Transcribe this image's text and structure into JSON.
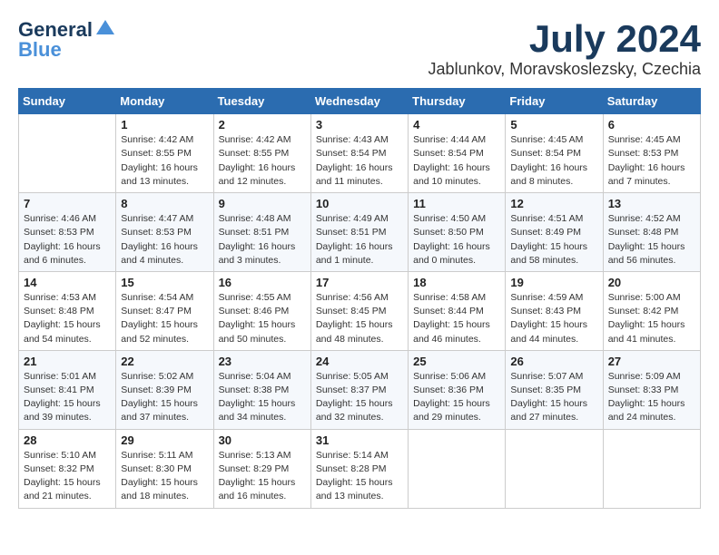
{
  "header": {
    "logo_general": "General",
    "logo_blue": "Blue",
    "title": "July 2024",
    "subtitle": "Jablunkov, Moravskoslezsky, Czechia"
  },
  "days_of_week": [
    "Sunday",
    "Monday",
    "Tuesday",
    "Wednesday",
    "Thursday",
    "Friday",
    "Saturday"
  ],
  "weeks": [
    [
      {
        "day": "",
        "content": ""
      },
      {
        "day": "1",
        "content": "Sunrise: 4:42 AM\nSunset: 8:55 PM\nDaylight: 16 hours\nand 13 minutes."
      },
      {
        "day": "2",
        "content": "Sunrise: 4:42 AM\nSunset: 8:55 PM\nDaylight: 16 hours\nand 12 minutes."
      },
      {
        "day": "3",
        "content": "Sunrise: 4:43 AM\nSunset: 8:54 PM\nDaylight: 16 hours\nand 11 minutes."
      },
      {
        "day": "4",
        "content": "Sunrise: 4:44 AM\nSunset: 8:54 PM\nDaylight: 16 hours\nand 10 minutes."
      },
      {
        "day": "5",
        "content": "Sunrise: 4:45 AM\nSunset: 8:54 PM\nDaylight: 16 hours\nand 8 minutes."
      },
      {
        "day": "6",
        "content": "Sunrise: 4:45 AM\nSunset: 8:53 PM\nDaylight: 16 hours\nand 7 minutes."
      }
    ],
    [
      {
        "day": "7",
        "content": "Sunrise: 4:46 AM\nSunset: 8:53 PM\nDaylight: 16 hours\nand 6 minutes."
      },
      {
        "day": "8",
        "content": "Sunrise: 4:47 AM\nSunset: 8:53 PM\nDaylight: 16 hours\nand 4 minutes."
      },
      {
        "day": "9",
        "content": "Sunrise: 4:48 AM\nSunset: 8:51 PM\nDaylight: 16 hours\nand 3 minutes."
      },
      {
        "day": "10",
        "content": "Sunrise: 4:49 AM\nSunset: 8:51 PM\nDaylight: 16 hours\nand 1 minute."
      },
      {
        "day": "11",
        "content": "Sunrise: 4:50 AM\nSunset: 8:50 PM\nDaylight: 16 hours\nand 0 minutes."
      },
      {
        "day": "12",
        "content": "Sunrise: 4:51 AM\nSunset: 8:49 PM\nDaylight: 15 hours\nand 58 minutes."
      },
      {
        "day": "13",
        "content": "Sunrise: 4:52 AM\nSunset: 8:48 PM\nDaylight: 15 hours\nand 56 minutes."
      }
    ],
    [
      {
        "day": "14",
        "content": "Sunrise: 4:53 AM\nSunset: 8:48 PM\nDaylight: 15 hours\nand 54 minutes."
      },
      {
        "day": "15",
        "content": "Sunrise: 4:54 AM\nSunset: 8:47 PM\nDaylight: 15 hours\nand 52 minutes."
      },
      {
        "day": "16",
        "content": "Sunrise: 4:55 AM\nSunset: 8:46 PM\nDaylight: 15 hours\nand 50 minutes."
      },
      {
        "day": "17",
        "content": "Sunrise: 4:56 AM\nSunset: 8:45 PM\nDaylight: 15 hours\nand 48 minutes."
      },
      {
        "day": "18",
        "content": "Sunrise: 4:58 AM\nSunset: 8:44 PM\nDaylight: 15 hours\nand 46 minutes."
      },
      {
        "day": "19",
        "content": "Sunrise: 4:59 AM\nSunset: 8:43 PM\nDaylight: 15 hours\nand 44 minutes."
      },
      {
        "day": "20",
        "content": "Sunrise: 5:00 AM\nSunset: 8:42 PM\nDaylight: 15 hours\nand 41 minutes."
      }
    ],
    [
      {
        "day": "21",
        "content": "Sunrise: 5:01 AM\nSunset: 8:41 PM\nDaylight: 15 hours\nand 39 minutes."
      },
      {
        "day": "22",
        "content": "Sunrise: 5:02 AM\nSunset: 8:39 PM\nDaylight: 15 hours\nand 37 minutes."
      },
      {
        "day": "23",
        "content": "Sunrise: 5:04 AM\nSunset: 8:38 PM\nDaylight: 15 hours\nand 34 minutes."
      },
      {
        "day": "24",
        "content": "Sunrise: 5:05 AM\nSunset: 8:37 PM\nDaylight: 15 hours\nand 32 minutes."
      },
      {
        "day": "25",
        "content": "Sunrise: 5:06 AM\nSunset: 8:36 PM\nDaylight: 15 hours\nand 29 minutes."
      },
      {
        "day": "26",
        "content": "Sunrise: 5:07 AM\nSunset: 8:35 PM\nDaylight: 15 hours\nand 27 minutes."
      },
      {
        "day": "27",
        "content": "Sunrise: 5:09 AM\nSunset: 8:33 PM\nDaylight: 15 hours\nand 24 minutes."
      }
    ],
    [
      {
        "day": "28",
        "content": "Sunrise: 5:10 AM\nSunset: 8:32 PM\nDaylight: 15 hours\nand 21 minutes."
      },
      {
        "day": "29",
        "content": "Sunrise: 5:11 AM\nSunset: 8:30 PM\nDaylight: 15 hours\nand 18 minutes."
      },
      {
        "day": "30",
        "content": "Sunrise: 5:13 AM\nSunset: 8:29 PM\nDaylight: 15 hours\nand 16 minutes."
      },
      {
        "day": "31",
        "content": "Sunrise: 5:14 AM\nSunset: 8:28 PM\nDaylight: 15 hours\nand 13 minutes."
      },
      {
        "day": "",
        "content": ""
      },
      {
        "day": "",
        "content": ""
      },
      {
        "day": "",
        "content": ""
      }
    ]
  ]
}
